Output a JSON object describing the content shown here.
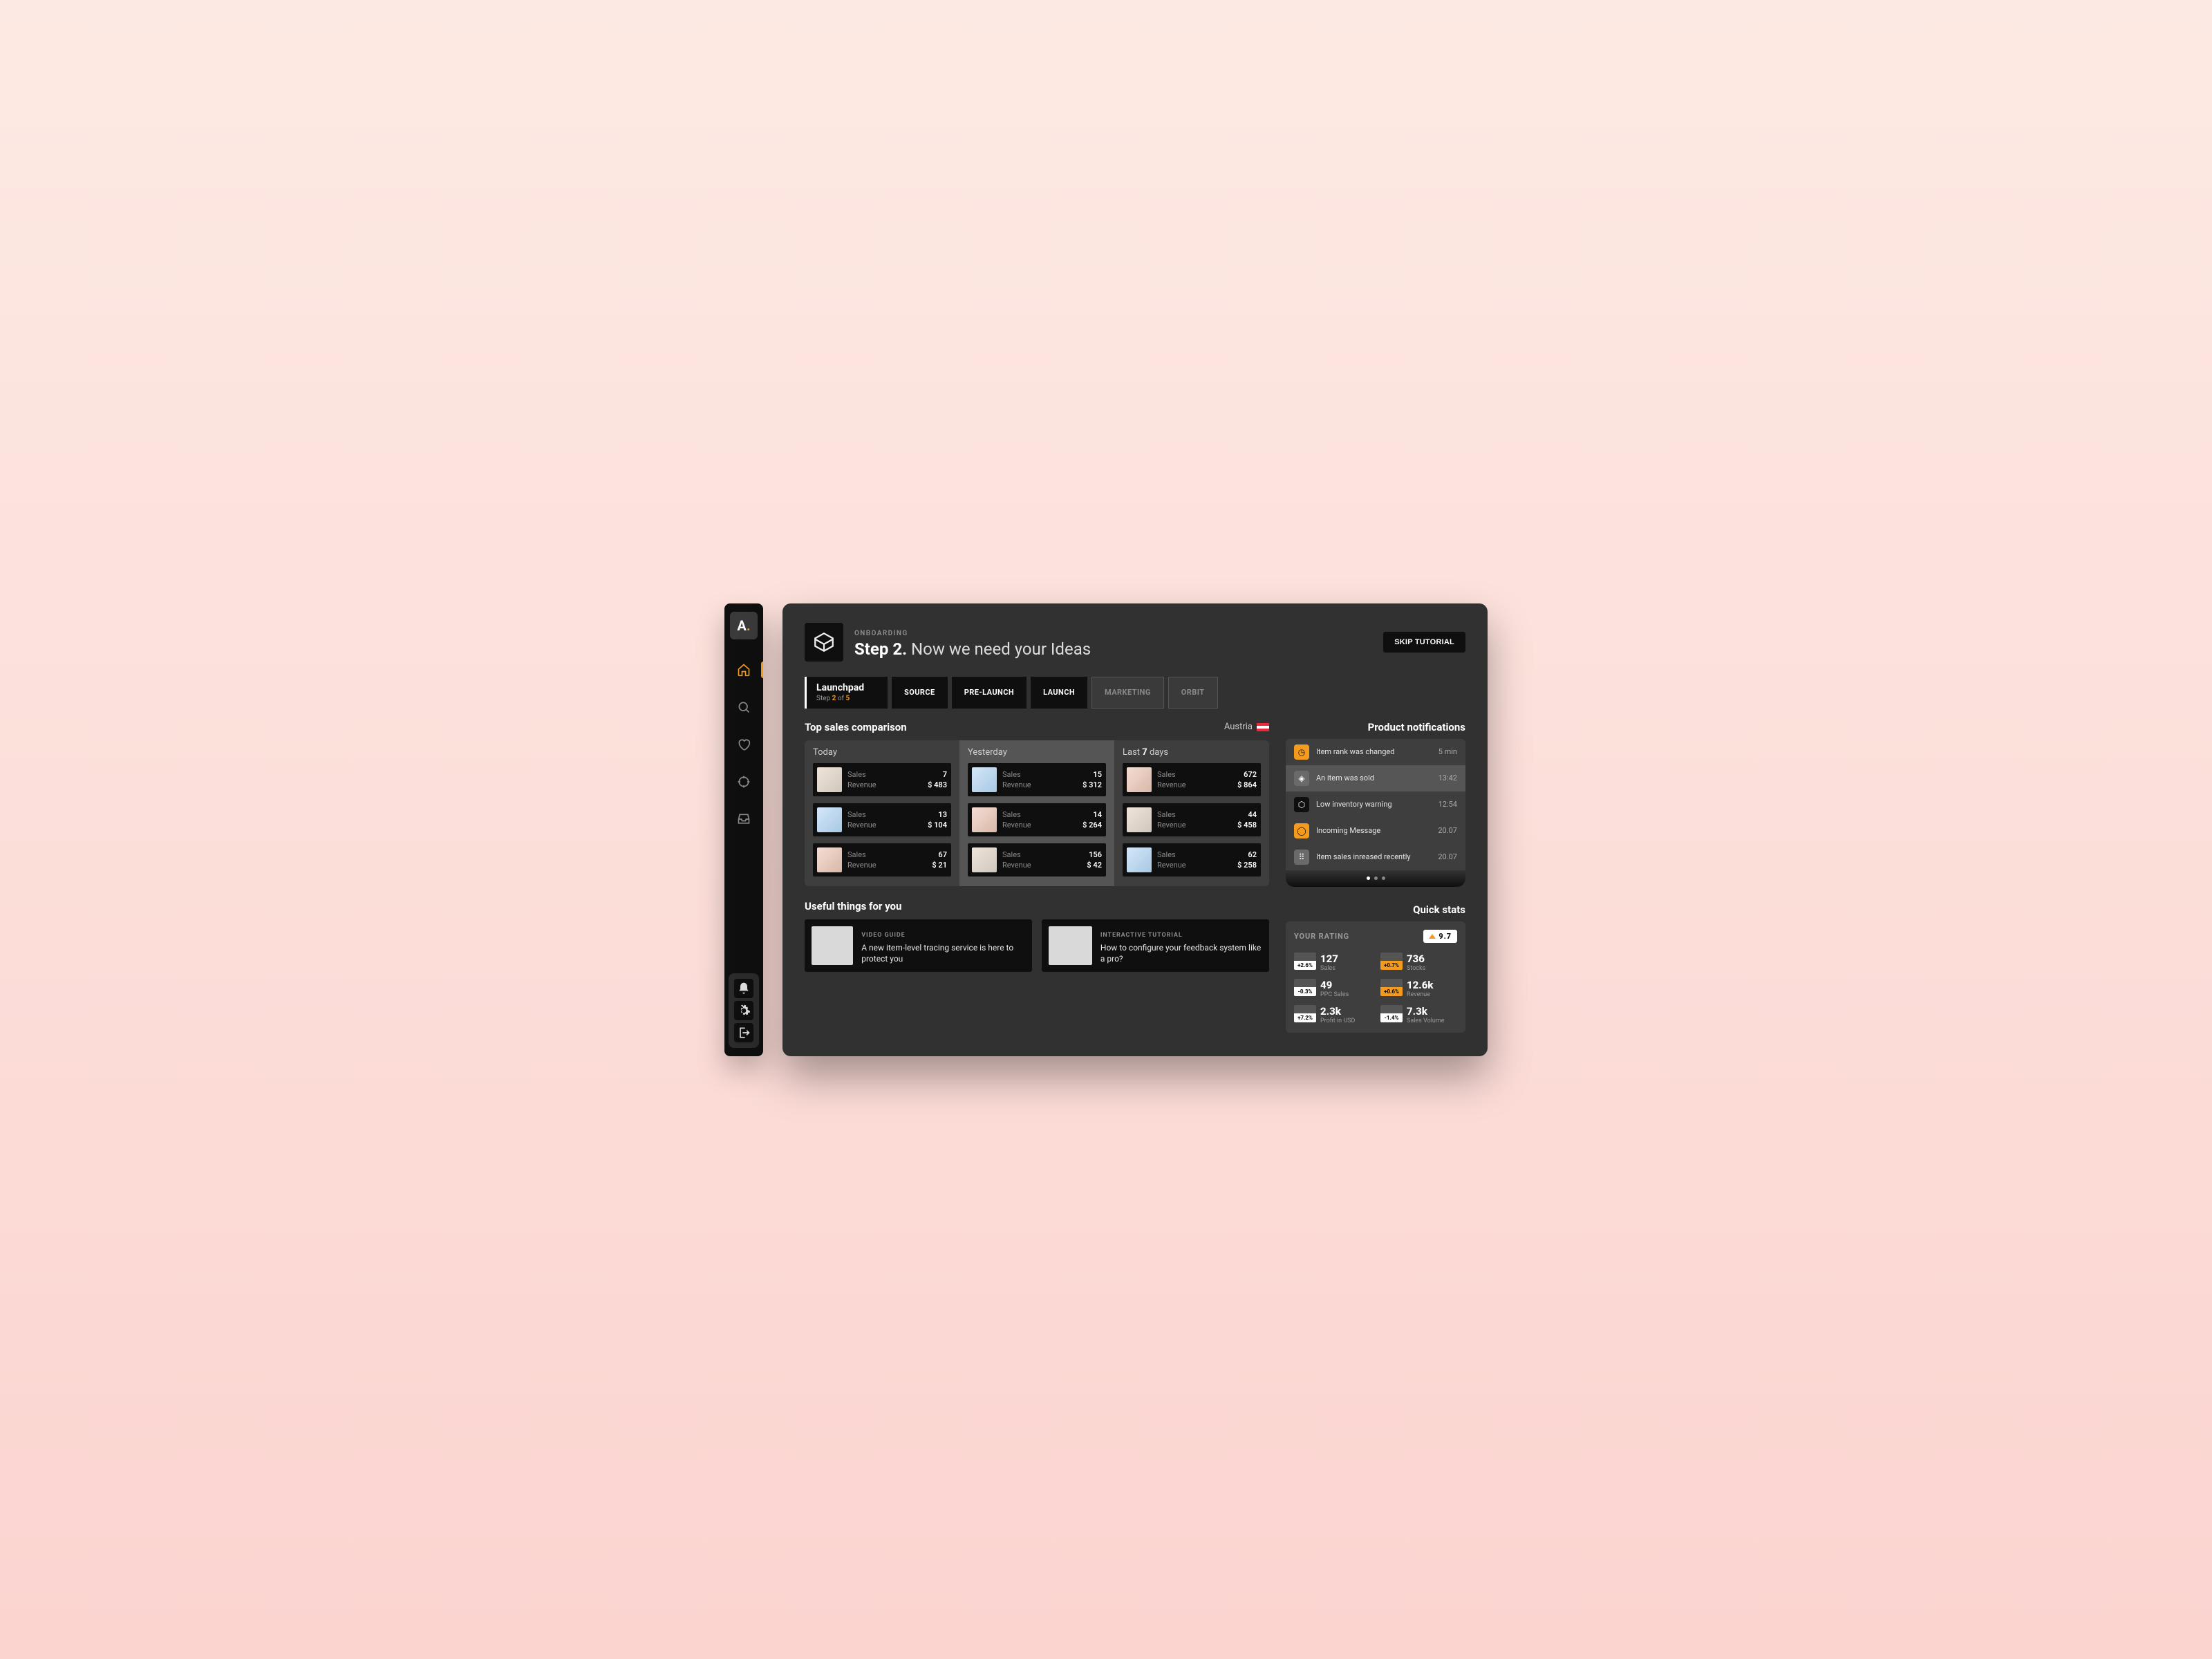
{
  "sidebar": {
    "logo_letter": "A"
  },
  "header": {
    "kicker": "ONBOARDING",
    "step_label": "Step 2.",
    "subtitle": "Now we need your Ideas",
    "skip_label": "SKIP TUTORIAL"
  },
  "launchpad": {
    "title": "Launchpad",
    "step_prefix": "Step ",
    "step_current": "2",
    "step_of": " of ",
    "step_total": "5"
  },
  "tabs": [
    {
      "label": "SOURCE",
      "disabled": false
    },
    {
      "label": "PRE-LAUNCH",
      "disabled": false
    },
    {
      "label": "LAUNCH",
      "disabled": false
    },
    {
      "label": "MARKETING",
      "disabled": true
    },
    {
      "label": "ORBIT",
      "disabled": true
    }
  ],
  "sales": {
    "title": "Top sales comparison",
    "country": "Austria",
    "columns": [
      {
        "title": "Today",
        "title_bold": "",
        "rows": [
          {
            "sales": "7",
            "revenue": "$ 483"
          },
          {
            "sales": "13",
            "revenue": "$ 104"
          },
          {
            "sales": "67",
            "revenue": "$ 21"
          }
        ]
      },
      {
        "title": "Yesterday",
        "title_bold": "",
        "rows": [
          {
            "sales": "15",
            "revenue": "$ 312"
          },
          {
            "sales": "14",
            "revenue": "$ 264"
          },
          {
            "sales": "156",
            "revenue": "$ 42"
          }
        ]
      },
      {
        "title": "Last ",
        "title_bold": "7",
        "title_suffix": " days",
        "rows": [
          {
            "sales": "672",
            "revenue": "$ 864"
          },
          {
            "sales": "44",
            "revenue": "$ 458"
          },
          {
            "sales": "62",
            "revenue": "$ 258"
          }
        ]
      }
    ],
    "label_sales": "Sales",
    "label_revenue": "Revenue"
  },
  "useful": {
    "title": "Useful things for you",
    "cards": [
      {
        "kicker": "VIDEO GUIDE",
        "text": "A new item-level tracing service is here to protect you"
      },
      {
        "kicker": "INTERACTIVE TUTORIAL",
        "text": "How to configure your feedback system like a pro?"
      }
    ]
  },
  "notifications": {
    "title": "Product notifications",
    "items": [
      {
        "text": "Item rank was changed",
        "time": "5 min",
        "color": "orange",
        "glyph": "◷"
      },
      {
        "text": "An item was sold",
        "time": "13:42",
        "color": "gray",
        "glyph": "◈",
        "selected": true
      },
      {
        "text": "Low inventory warning",
        "time": "12:54",
        "color": "dark",
        "glyph": "⬡"
      },
      {
        "text": "Incoming Message",
        "time": "20.07",
        "color": "orange",
        "glyph": "◯"
      },
      {
        "text": "Item sales inreased recently",
        "time": "20.07",
        "color": "gray",
        "glyph": "⠿"
      }
    ]
  },
  "quickstats": {
    "title": "Quick stats",
    "rating_label": "YOUR RATING",
    "rating_value": "9.7",
    "items": [
      {
        "pct": "+2.6%",
        "pct_style": "white",
        "value": "127",
        "label": "Sales"
      },
      {
        "pct": "+0.7%",
        "pct_style": "orange",
        "value": "736",
        "label": "Stocks"
      },
      {
        "pct": "-0.3%",
        "pct_style": "white",
        "value": "49",
        "label": "PPC Sales"
      },
      {
        "pct": "+0.6%",
        "pct_style": "orange",
        "value": "12.6k",
        "label": "Revenue"
      },
      {
        "pct": "+7.2%",
        "pct_style": "white",
        "value": "2.3k",
        "label": "Profit in USD"
      },
      {
        "pct": "-1.4%",
        "pct_style": "white",
        "value": "7.3k",
        "label": "Sales Volume"
      }
    ]
  }
}
